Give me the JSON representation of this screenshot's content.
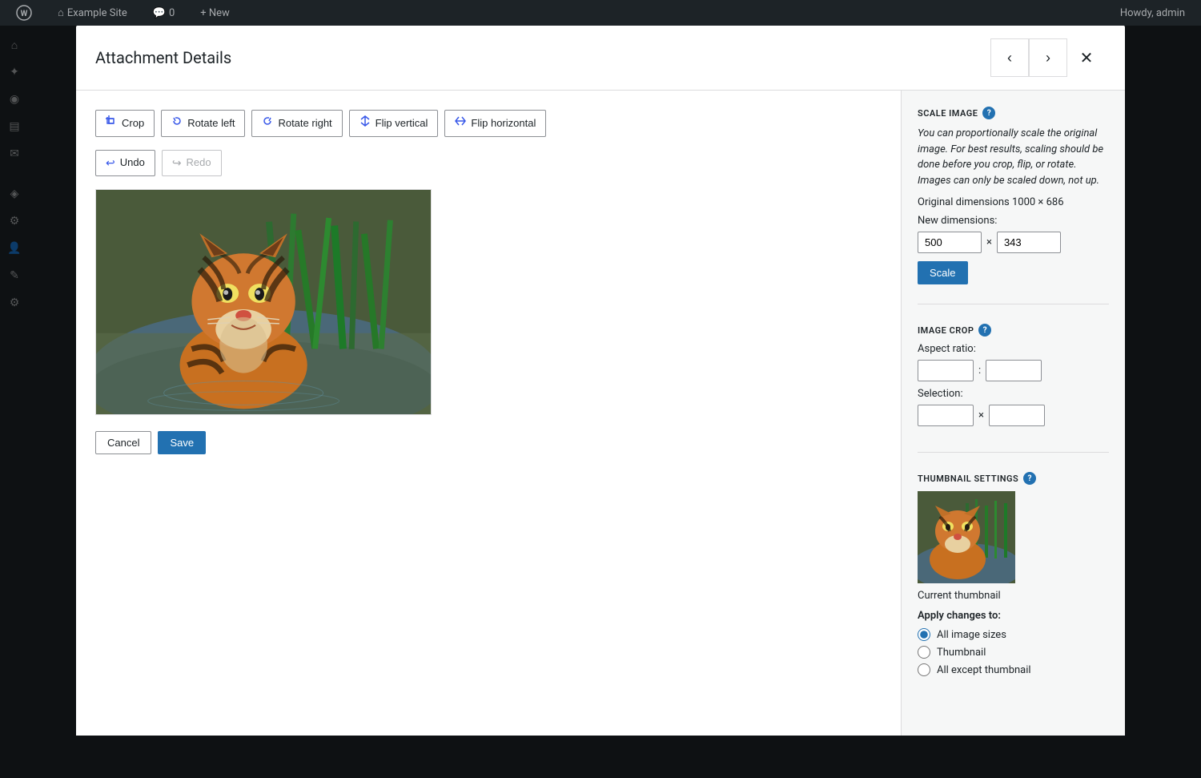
{
  "adminBar": {
    "siteName": "Example Site",
    "commentCount": "0",
    "newLabel": "+ New",
    "userLabel": "Howdy, admin"
  },
  "modal": {
    "title": "Attachment Details",
    "prevButton": "‹",
    "nextButton": "›",
    "closeButton": "✕"
  },
  "toolbar": {
    "cropLabel": "Crop",
    "rotateLeftLabel": "Rotate left",
    "rotateRightLabel": "Rotate right",
    "flipVerticalLabel": "Flip vertical",
    "flipHorizontalLabel": "Flip horizontal",
    "undoLabel": "Undo",
    "redoLabel": "Redo"
  },
  "actions": {
    "cancelLabel": "Cancel",
    "saveLabel": "Save"
  },
  "scaleImage": {
    "title": "SCALE IMAGE",
    "description": "You can proportionally scale the original image. For best results, scaling should be done before you crop, flip, or rotate. Images can only be scaled down, not up.",
    "originalDimensions": "Original dimensions 1000 × 686",
    "newDimensionsLabel": "New dimensions:",
    "widthValue": "500",
    "heightValue": "343",
    "separator": "×",
    "scaleButtonLabel": "Scale"
  },
  "imageCrop": {
    "title": "IMAGE CROP",
    "aspectRatioLabel": "Aspect ratio:",
    "aspectWidth": "",
    "aspectHeight": "",
    "separator": ":",
    "selectionLabel": "Selection:",
    "selectionWidth": "",
    "selectionHeight": "",
    "selSeparator": "×"
  },
  "thumbnailSettings": {
    "title": "THUMBNAIL SETTINGS",
    "currentThumbnailLabel": "Current thumbnail",
    "applyChangesLabel": "Apply changes to:",
    "options": [
      {
        "label": "All image sizes",
        "value": "all",
        "checked": true
      },
      {
        "label": "Thumbnail",
        "value": "thumbnail",
        "checked": false
      },
      {
        "label": "All except thumbnail",
        "value": "except-thumbnail",
        "checked": false
      }
    ]
  },
  "sidebar": {
    "items": [
      {
        "icon": "⌂",
        "label": "Dashboard"
      },
      {
        "icon": "✦",
        "label": "Posts"
      },
      {
        "icon": "◉",
        "label": "Media"
      },
      {
        "icon": "▤",
        "label": "Pages"
      },
      {
        "icon": "✉",
        "label": "Comments"
      },
      {
        "icon": "◈",
        "label": "Appearance"
      },
      {
        "icon": "⚙",
        "label": "Plugins"
      },
      {
        "icon": "👤",
        "label": "Users"
      },
      {
        "icon": "✎",
        "label": "Tools"
      },
      {
        "icon": "⚙",
        "label": "Settings"
      }
    ]
  }
}
